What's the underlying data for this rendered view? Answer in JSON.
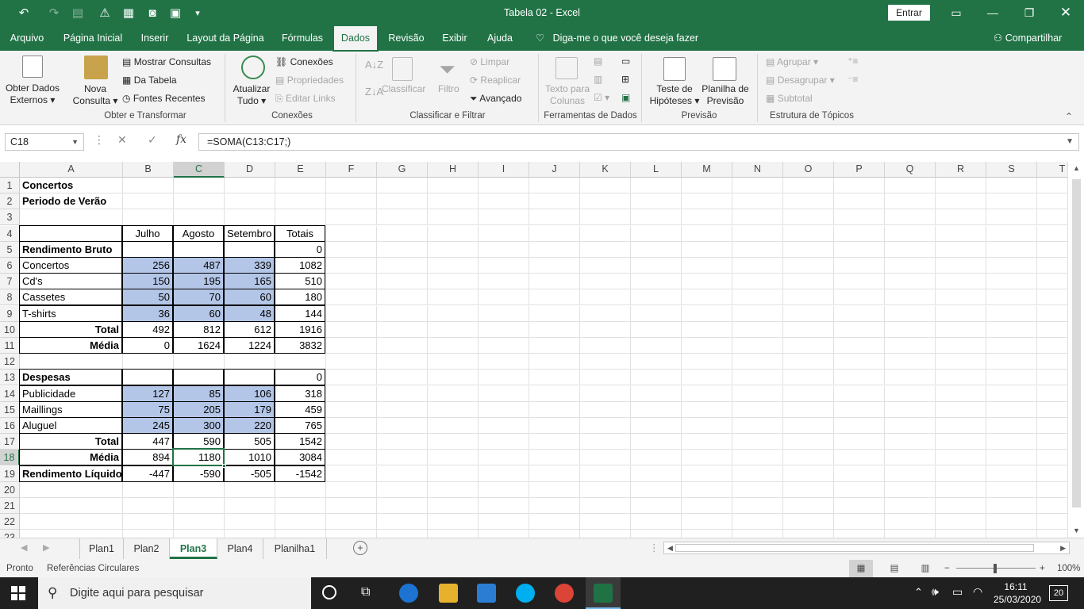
{
  "window": {
    "title": "Tabela 02  -  Excel",
    "signin": "Entrar"
  },
  "tabs": [
    "Arquivo",
    "Página Inicial",
    "Inserir",
    "Layout da Página",
    "Fórmulas",
    "Dados",
    "Revisão",
    "Exibir",
    "Ajuda"
  ],
  "tellme": "Diga-me o que você deseja fazer",
  "share": "Compartilhar",
  "ribbon": {
    "obter": "Obter Dados",
    "externos": "Externos",
    "nova": "Nova",
    "consulta": "Consulta",
    "mostrar": "Mostrar Consultas",
    "datab": "Da Tabela",
    "fontes": "Fontes Recentes",
    "grp1": "Obter e Transformar",
    "atualizar": "Atualizar",
    "tudo": "Tudo",
    "conexoes": "Conexões",
    "propriedades": "Propriedades",
    "editar": "Editar Links",
    "grp2": "Conexões",
    "classificar": "Classificar",
    "filtro": "Filtro",
    "limpar": "Limpar",
    "reaplicar": "Reaplicar",
    "avancado": "Avançado",
    "grp3": "Classificar e Filtrar",
    "texto": "Texto para",
    "colunas": "Colunas",
    "grp4": "Ferramentas de Dados",
    "teste": "Teste de",
    "hipoteses": "Hipóteses",
    "planilha": "Planilha de",
    "previsao": "Previsão",
    "grp5": "Previsão",
    "agrupar": "Agrupar",
    "desagrupar": "Desagrupar",
    "subtotal": "Subtotal",
    "grp6": "Estrutura de Tópicos"
  },
  "formula": {
    "namebox": "C18",
    "fx": "fx",
    "content": "=SOMA(C13:C17;)"
  },
  "columns": [
    "A",
    "B",
    "C",
    "D",
    "E",
    "F",
    "G",
    "H",
    "I",
    "J",
    "K",
    "L",
    "M",
    "N",
    "O",
    "P",
    "Q",
    "R",
    "S",
    "T"
  ],
  "rows": [
    "1",
    "2",
    "3",
    "4",
    "5",
    "6",
    "7",
    "8",
    "9",
    "10",
    "11",
    "12",
    "13",
    "14",
    "15",
    "16",
    "17",
    "18",
    "19",
    "20",
    "21",
    "22",
    "23"
  ],
  "cells": {
    "r1": [
      "Concertos",
      "",
      "",
      "",
      ""
    ],
    "r2": [
      "Periodo de Verão",
      "",
      "",
      "",
      ""
    ],
    "r4": [
      "",
      "Julho",
      "Agosto",
      "Setembro",
      "Totais"
    ],
    "r5": [
      "Rendimento Bruto",
      "",
      "",
      "",
      "0"
    ],
    "r6": [
      "Concertos",
      "256",
      "487",
      "339",
      "1082"
    ],
    "r7": [
      "Cd's",
      "150",
      "195",
      "165",
      "510"
    ],
    "r8": [
      "Cassetes",
      "50",
      "70",
      "60",
      "180"
    ],
    "r9": [
      "T-shirts",
      "36",
      "60",
      "48",
      "144"
    ],
    "r10": [
      "Total",
      "492",
      "812",
      "612",
      "1916"
    ],
    "r11": [
      "Média",
      "0",
      "1624",
      "1224",
      "3832"
    ],
    "r13": [
      "Despesas",
      "",
      "",
      "",
      "0"
    ],
    "r14": [
      "Publicidade",
      "127",
      "85",
      "106",
      "318"
    ],
    "r15": [
      "Maillings",
      "75",
      "205",
      "179",
      "459"
    ],
    "r16": [
      "Aluguel",
      "245",
      "300",
      "220",
      "765"
    ],
    "r17": [
      "Total",
      "447",
      "590",
      "505",
      "1542"
    ],
    "r18": [
      "Média",
      "894",
      "1180",
      "1010",
      "3084"
    ],
    "r19": [
      "Rendimento Líquido",
      "-447",
      "-590",
      "-505",
      "-1542"
    ]
  },
  "sheets": [
    "Plan1",
    "Plan2",
    "Plan3",
    "Plan4",
    "Planilha1"
  ],
  "status": {
    "ready": "Pronto",
    "circ": "Referências Circulares",
    "zoom": "100%"
  },
  "taskbar": {
    "search": "Digite aqui para pesquisar",
    "time": "16:11",
    "date": "25/03/2020",
    "notif": "20"
  }
}
